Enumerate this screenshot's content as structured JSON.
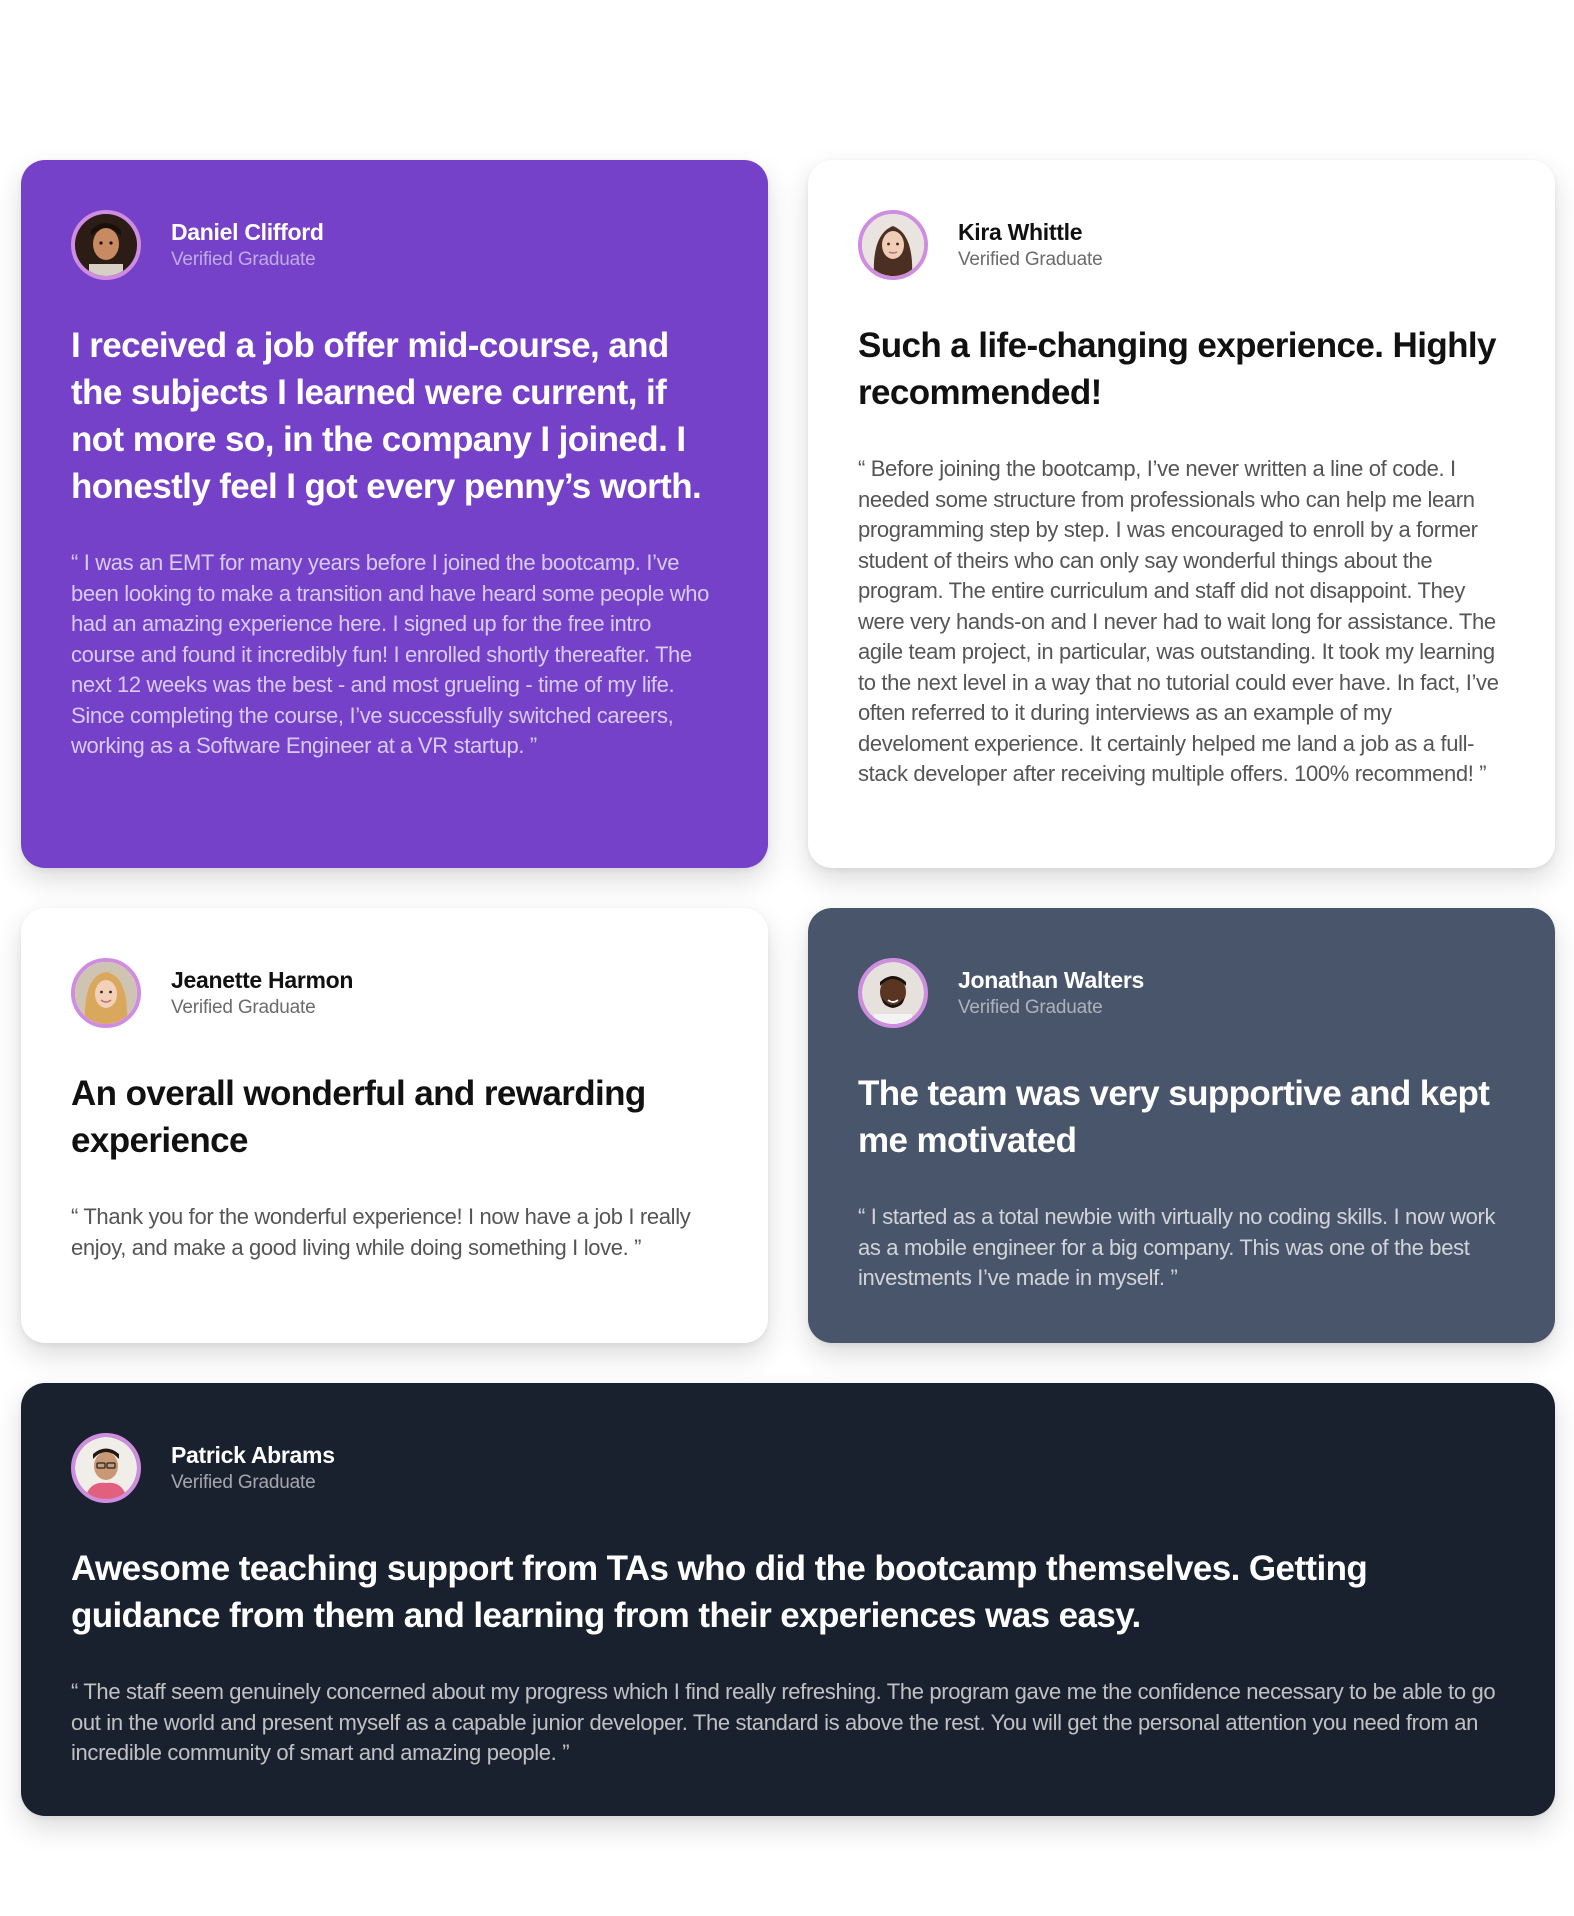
{
  "testimonials": [
    {
      "name": "Daniel Clifford",
      "role": "Verified Graduate",
      "headline": "I received a job offer mid-course, and the subjects I learned were current, if not more so, in the company I joined. I honestly feel I got every penny’s worth.",
      "quote": "“ I was an EMT for many years before I joined the bootcamp. I’ve been looking to make a transition and have heard some people who had an amazing experience here. I signed up for the free intro course and found it incredibly fun! I enrolled shortly thereafter. The next 12 weeks was the best - and most grueling - time of my life. Since completing the course, I’ve successfully switched careers, working as a Software Engineer at a VR startup. ”",
      "background": "#7541c8"
    },
    {
      "name": "Kira Whittle",
      "role": "Verified Graduate",
      "headline": "Such a life-changing experience. Highly recommended!",
      "quote": "“ Before joining the bootcamp, I’ve never written a line of code. I needed some structure from professionals who can help me learn programming step by step. I was encouraged to enroll by a former student of theirs who can only say wonderful things about the program. The entire curriculum and staff did not disappoint. They were very hands-on and I never had to wait long for assistance. The agile team project, in particular, was outstanding. It took my learning to the next level in a way that no tutorial could ever have. In fact, I’ve often referred to it during interviews as an example of my develoment experience. It certainly helped me land a job as a full-stack developer after receiving multiple offers. 100% recommend! ”",
      "background": "#ffffff"
    },
    {
      "name": "Jeanette Harmon",
      "role": "Verified Graduate",
      "headline": "An overall wonderful and rewarding experience",
      "quote": "“ Thank you for the wonderful experience! I now have a job I really enjoy, and make a good living while doing something I love. ”",
      "background": "#ffffff"
    },
    {
      "name": "Jonathan Walters",
      "role": "Verified Graduate",
      "headline": "The team was very supportive and kept me motivated",
      "quote": "“ I started as a total newbie with virtually no coding skills. I now work as a mobile engineer for a big company. This was one of the best investments I’ve made in myself. ”",
      "background": "#48556a"
    },
    {
      "name": "Patrick Abrams",
      "role": "Verified Graduate",
      "headline": "Awesome teaching support from TAs who did the bootcamp themselves. Getting guidance from them and learning from their experiences was easy.",
      "quote": "“ The staff seem genuinely concerned about my progress which I find really refreshing. The program gave me the confidence necessary to be able to go out in the world and present myself as a capable junior developer. The standard is above the rest. You will get the personal attention you need from an incredible community of smart and amazing people. ”",
      "background": "#19212e"
    }
  ],
  "colors": {
    "avatar_border": "#cf8de0",
    "page_background": "#ffffff"
  }
}
